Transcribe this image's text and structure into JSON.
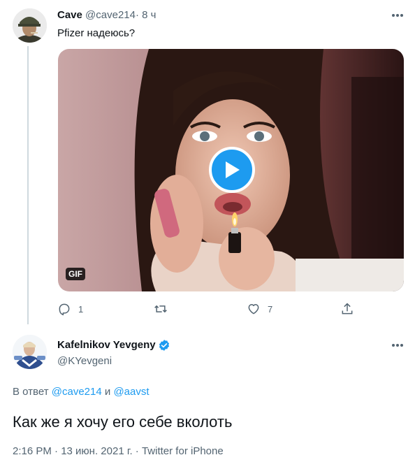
{
  "reply_tweet": {
    "author_name": "Cave",
    "handle": "@cave214",
    "separator": "·",
    "time": "8 ч",
    "text": "Pfizer надеюсь?",
    "media": {
      "badge": "GIF",
      "icon": "play-icon"
    },
    "actions": {
      "reply": {
        "icon": "reply-icon",
        "count": "1"
      },
      "retweet": {
        "icon": "retweet-icon",
        "count": ""
      },
      "like": {
        "icon": "heart-icon",
        "count": "7"
      },
      "share": {
        "icon": "share-icon"
      }
    }
  },
  "main_tweet": {
    "author_name": "Kafelnikov Yevgeny",
    "verified": true,
    "handle": "@KYevgeni",
    "reply_prefix": "В ответ",
    "reply_mentions": [
      "@cave214",
      "@aavst"
    ],
    "reply_joiner": "и",
    "text": "Как же я хочу его себе вколоть",
    "timestamp": "2:16 PM · 13 июн. 2021 г. · ",
    "source": "Twitter for iPhone"
  },
  "colors": {
    "accent": "#1d9bf0",
    "text": "#0f1419",
    "secondary": "#536471",
    "thread_line": "#cfd9de"
  }
}
